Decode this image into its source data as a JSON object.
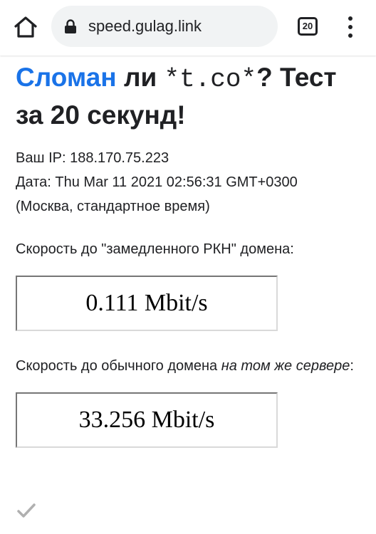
{
  "browser": {
    "url": "speed.gulag.link",
    "tab_count": "20",
    "icons": [
      "home-icon",
      "lock-icon",
      "tab-switcher-icon",
      "overflow-menu-icon"
    ]
  },
  "page": {
    "title_brand": "Сломан",
    "title_mid": " ли ",
    "title_code": "*t.co*",
    "title_end": "? Тест за 20 секунд!",
    "ip_line": "Ваш IP: 188.170.75.223",
    "date_line": "Дата: Thu Mar 11 2021 02:56:31 GMT+0300",
    "tz_line": "(Москва, стандартное время)",
    "slow_label": "Скорость до \"замедленного РКН\" домена:",
    "slow_speed": "0.111 Mbit/s",
    "normal_label_start": "Скорость до обычного домена ",
    "normal_label_em": "на том же сервере",
    "normal_label_end": ":",
    "normal_speed": "33.256 Mbit/s",
    "status_icon": "checkmark-icon"
  },
  "colors": {
    "brand": "#1a73e8",
    "text": "#202124",
    "omnibox": "#f1f3f4",
    "check": "#b0b0b0"
  }
}
